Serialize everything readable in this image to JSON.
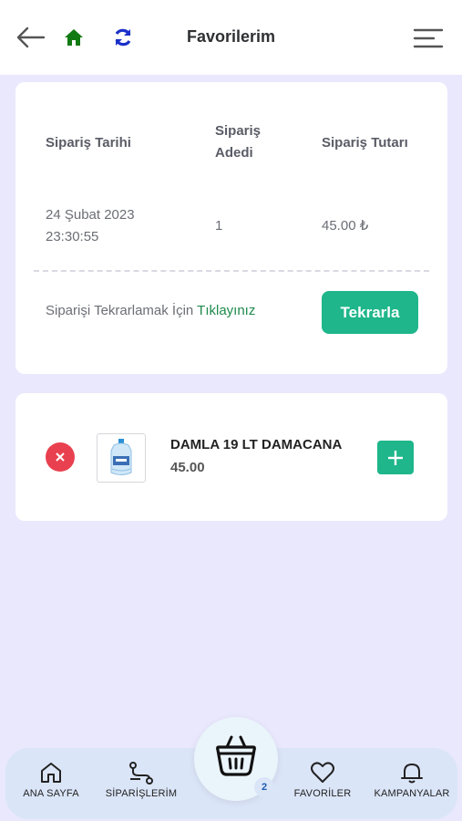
{
  "header": {
    "title": "Favorilerim",
    "icons": [
      "back-arrow-icon",
      "home-icon",
      "refresh-icon",
      "menu-icon"
    ],
    "colors": {
      "home": "#127a12",
      "refresh": "#1b30c9"
    }
  },
  "order": {
    "headers": {
      "date": "Sipariş Tarihi",
      "qty": "Sipariş Adedi",
      "total": "Sipariş Tutarı"
    },
    "row": {
      "date": "24 Şubat 2023 23:30:55",
      "qty": "1",
      "total": "45.00 ₺"
    },
    "repeat_prefix": "Siparişi Tekrarlamak İçin ",
    "repeat_link": "Tıklayınız",
    "repeat_button": "Tekrarla"
  },
  "favorite": {
    "name": "DAMLA 19 LT DAMACANA",
    "price": "45.00"
  },
  "nav": {
    "home": "ANA SAYFA",
    "orders": "SİPARİŞLERİM",
    "favorites": "FAVORİLER",
    "campaigns": "KAMPANYALAR",
    "basket_count": "2"
  },
  "colors": {
    "accent": "#1eb68a",
    "danger": "#e9404f",
    "background": "#e9e8fd"
  }
}
